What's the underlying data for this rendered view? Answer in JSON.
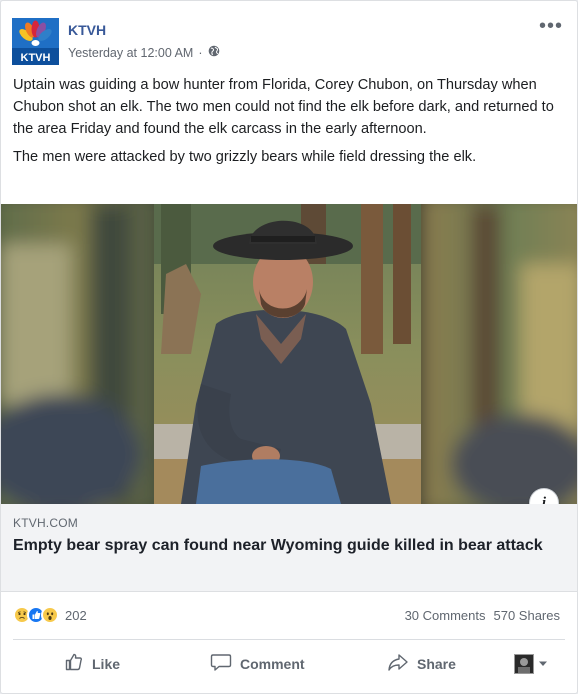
{
  "post": {
    "page_name": "KTVH",
    "avatar_text": "KTVH",
    "timestamp": "Yesterday at 12:00 AM",
    "separator": "·",
    "privacy_icon": "globe-icon",
    "menu_icon": "more-options-icon",
    "paragraphs": [
      "Uptain was guiding a bow hunter from Florida, Corey Chubon, on Thursday when Chubon shot an elk. The two men could not find the elk before dark, and returned to the area Friday and found the elk carcass in the early afternoon.",
      "The men were attacked by two grizzly bears while field dressing the elk."
    ]
  },
  "media": {
    "image_description_icon": "photo-of-man-in-cowboy-hat",
    "info_label": "i"
  },
  "link_preview": {
    "domain": "KTVH.COM",
    "title": "Empty bear spray can found near Wyoming guide killed in bear attack"
  },
  "engagement": {
    "reaction_icons": [
      "sad-reaction-icon",
      "like-reaction-icon",
      "wow-reaction-icon"
    ],
    "reaction_count": "202",
    "comments": "30 Comments",
    "shares": "570 Shares"
  },
  "actions": {
    "like": "Like",
    "comment": "Comment",
    "share": "Share"
  },
  "colors": {
    "link": "#385898",
    "brand_blue": "#1a5fb4",
    "muted": "#606770"
  }
}
